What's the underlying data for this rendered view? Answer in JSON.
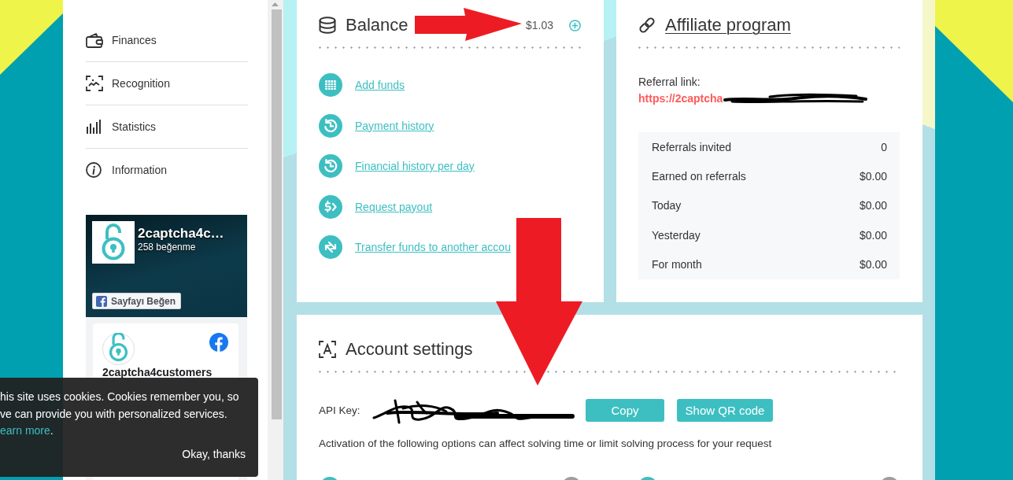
{
  "sidebar": {
    "items": [
      {
        "label": "Finances",
        "selected": false
      },
      {
        "label": "Recognition",
        "selected": false
      },
      {
        "label": "Statistics",
        "selected": false
      },
      {
        "label": "Information",
        "selected": false
      }
    ]
  },
  "facebook_widget": {
    "page_name": "2captcha4c…",
    "likes": "258 beğenme",
    "like_button": "Sayfayı Beğen",
    "post_author": "2captcha4customers"
  },
  "balance": {
    "title": "Balance",
    "amount": "$1.03",
    "links": [
      {
        "label": "Add funds"
      },
      {
        "label": "Payment history"
      },
      {
        "label": "Financial history per day"
      },
      {
        "label": "Request payout"
      },
      {
        "label": "Transfer funds to another accou"
      }
    ]
  },
  "affiliate": {
    "title": "Affiliate program",
    "referral_label": "Referral link:",
    "referral_link": "https://2captcha",
    "referral_redacted": true,
    "stats": [
      {
        "label": "Referrals invited",
        "value": "0"
      },
      {
        "label": "Earned on referrals",
        "value": "$0.00"
      },
      {
        "label": "Today",
        "value": "$0.00"
      },
      {
        "label": "Yesterday",
        "value": "$0.00"
      },
      {
        "label": "For month",
        "value": "$0.00"
      }
    ]
  },
  "account_settings": {
    "title": "Account settings",
    "api_key_label": "API Key:",
    "api_key_redacted": true,
    "buttons": [
      {
        "label": "Copy"
      },
      {
        "label": "Show QR code"
      }
    ],
    "note": "Activation of the following options can affect solving time or limit solving process for your request",
    "options": [
      {
        "on": false
      },
      {
        "on": false
      }
    ]
  },
  "cookie_banner": {
    "lines": [
      "his site uses cookies. Cookies remember you, so",
      "ve can provide you with personalized services."
    ],
    "link": "earn more",
    "link_end": ".",
    "button": "Okay, thanks"
  },
  "annotations": [
    {
      "kind": "rightarrow"
    },
    {
      "kind": "downarrow"
    }
  ]
}
